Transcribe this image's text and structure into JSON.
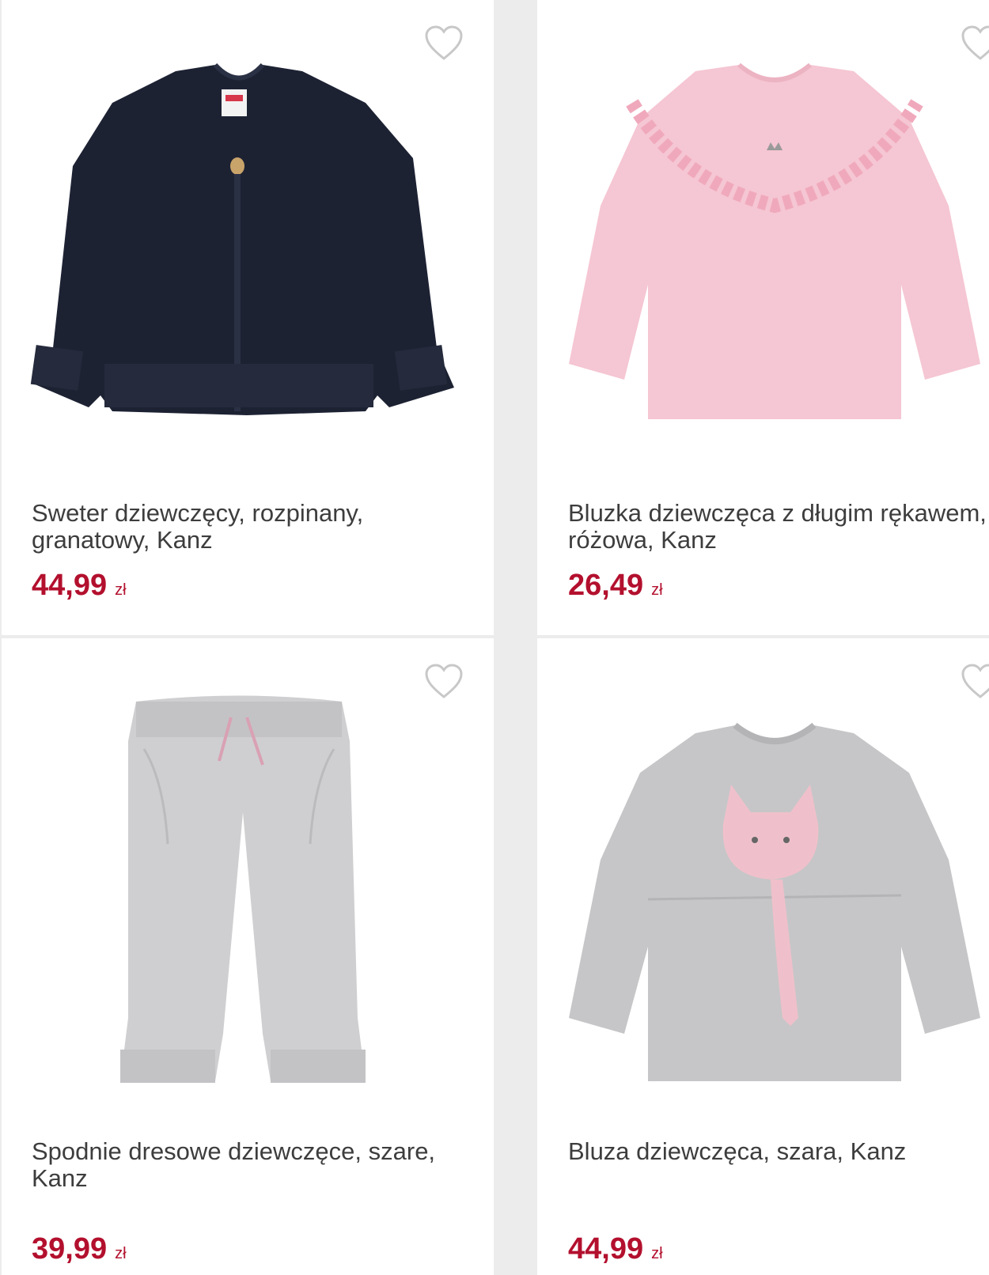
{
  "colors": {
    "price": "#b3102e",
    "title": "#3d3d3d",
    "divider": "#ececec"
  },
  "products": [
    {
      "title": "Sweter dziewczęcy, rozpinany, granatowy, Kanz",
      "price": "44,99",
      "currency": "zł",
      "image_icon": "navy-cardigan-image",
      "wishlist_icon": "heart-icon"
    },
    {
      "title": "Bluzka dziewczęca z długim rękawem, różowa, Kanz",
      "price": "26,49",
      "currency": "zł",
      "image_icon": "pink-blouse-image",
      "wishlist_icon": "heart-icon"
    },
    {
      "title": "Spodnie dresowe dziewczęce, szare, Kanz",
      "price": "39,99",
      "currency": "zł",
      "image_icon": "grey-sweatpants-image",
      "wishlist_icon": "heart-icon"
    },
    {
      "title": "Bluza dziewczęca, szara, Kanz",
      "price": "44,99",
      "currency": "zł",
      "image_icon": "grey-cat-sweatshirt-image",
      "wishlist_icon": "heart-icon"
    }
  ]
}
